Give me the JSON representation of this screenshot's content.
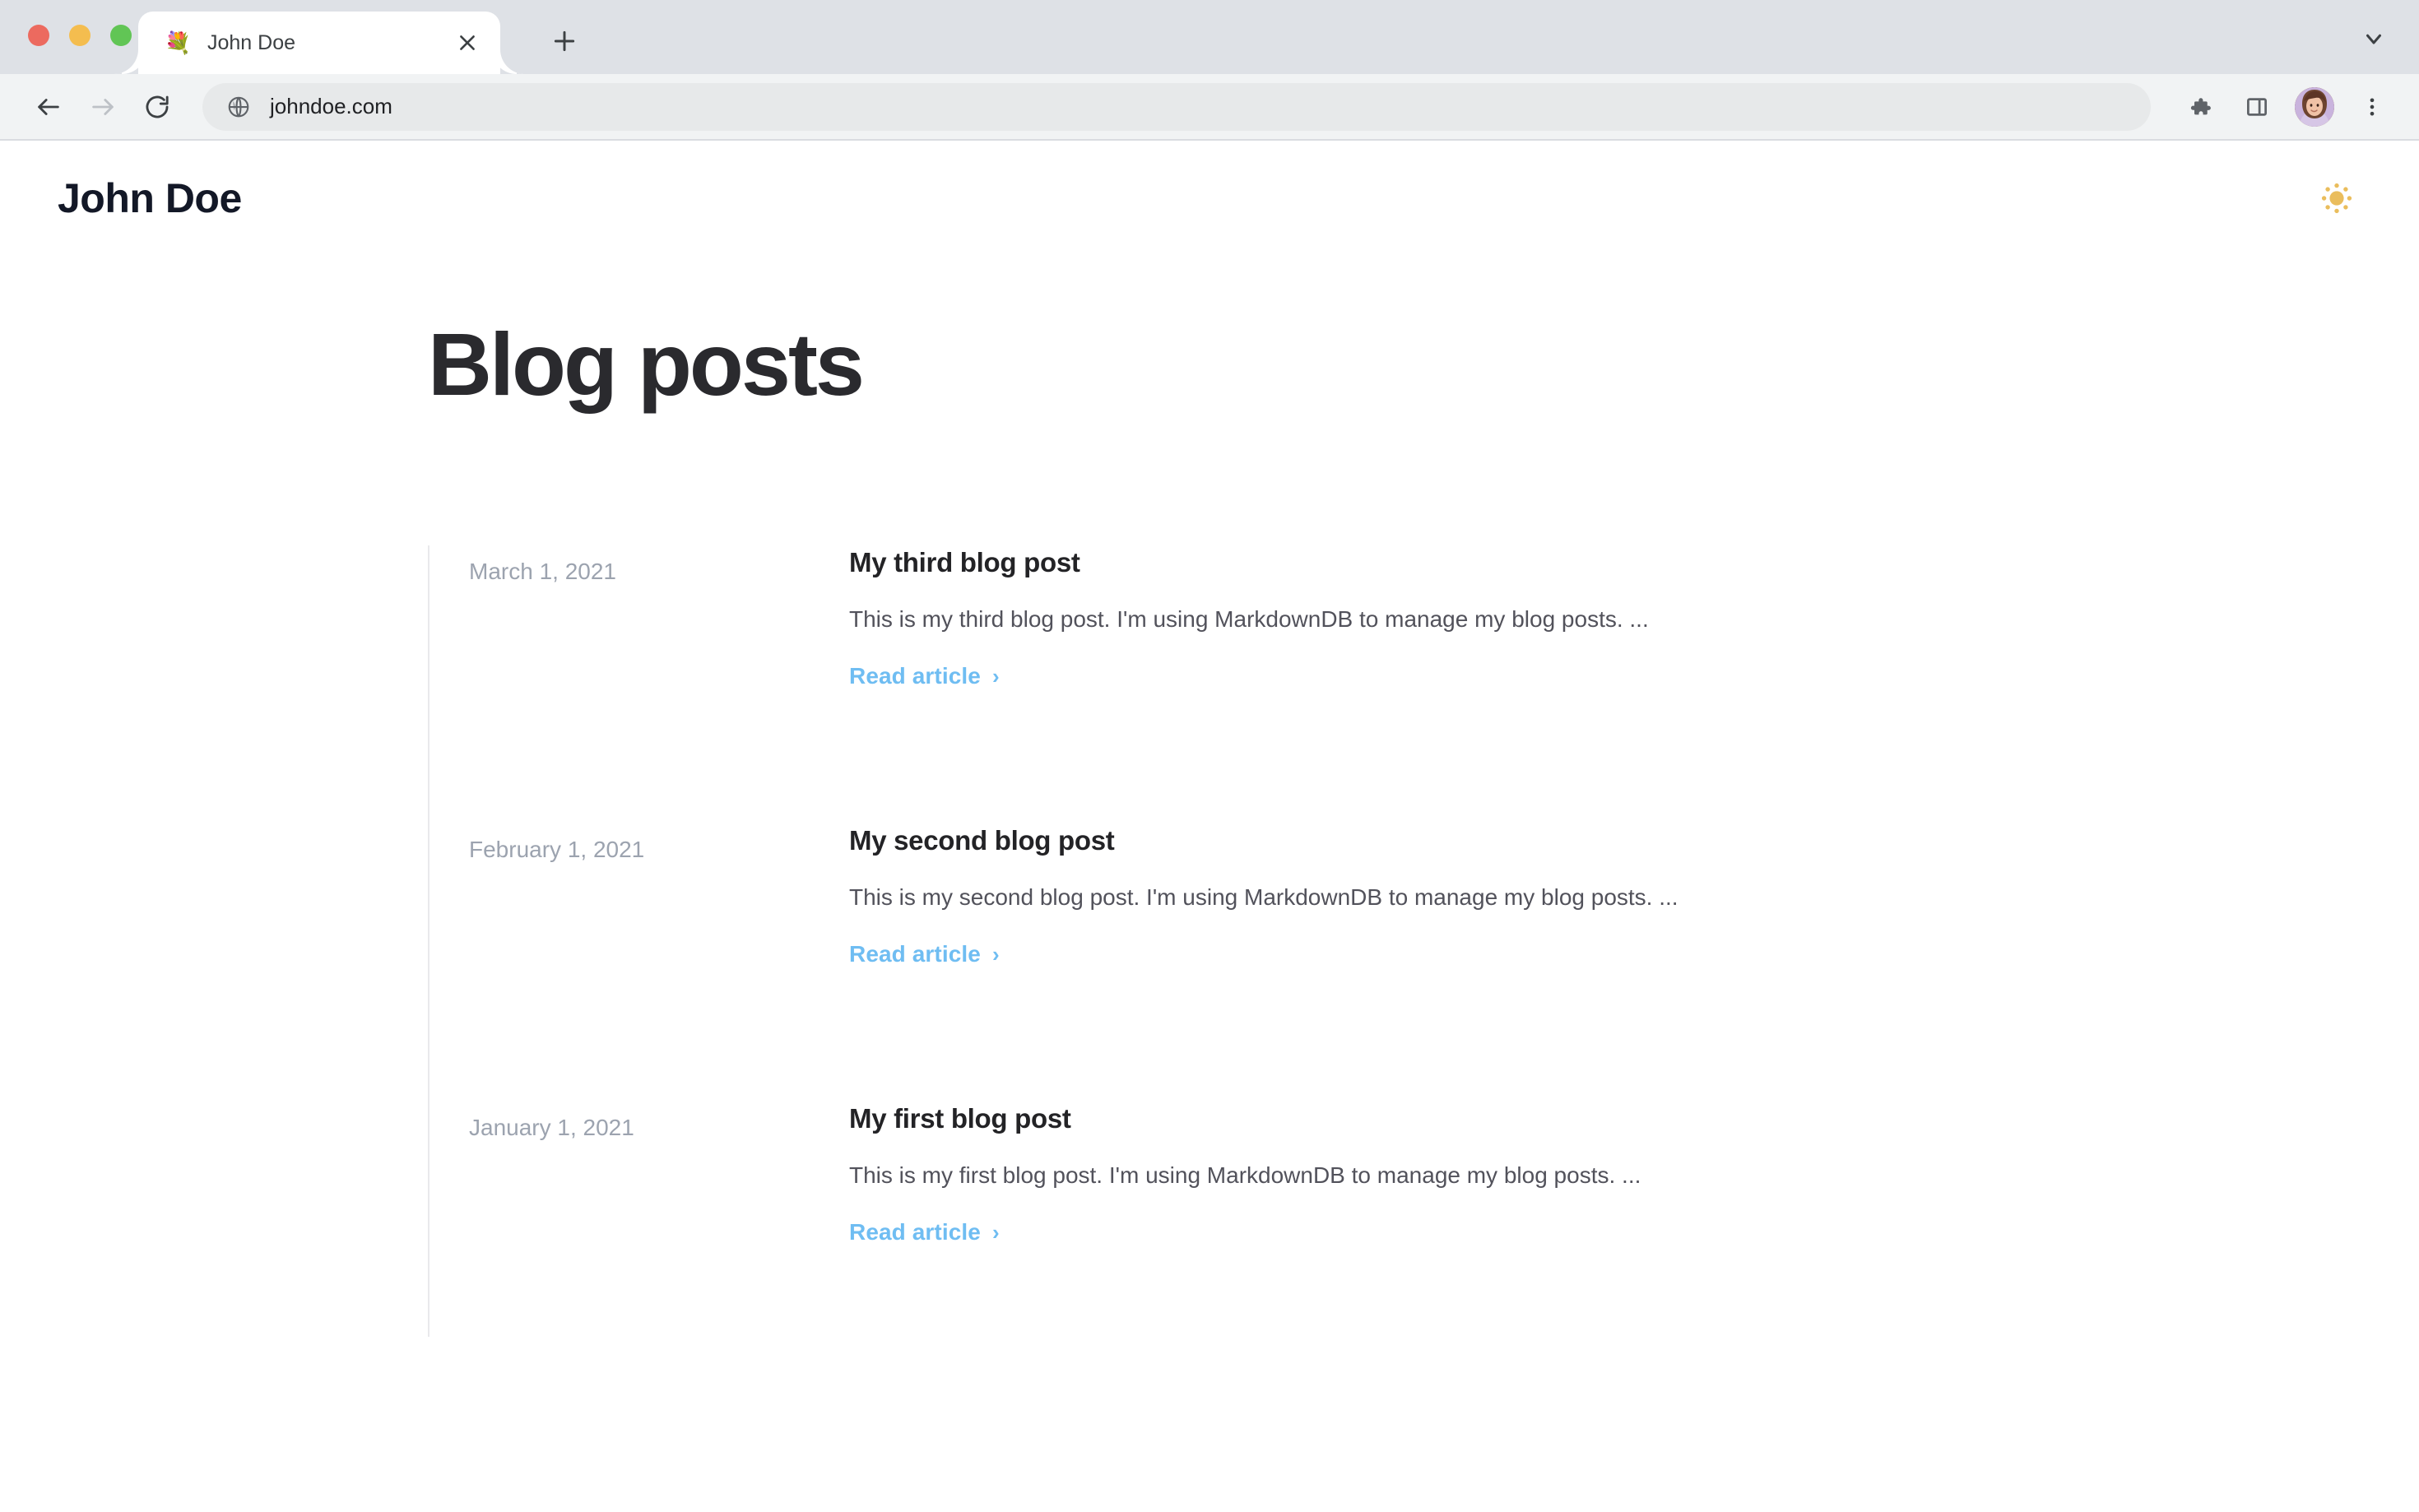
{
  "browser": {
    "window_controls": {
      "close_label": "close",
      "minimize_label": "minimize",
      "zoom_label": "zoom",
      "close_color": "#ec6a5f",
      "minimize_color": "#f4bd4f",
      "zoom_color": "#61c555"
    },
    "tab": {
      "favicon": "💐",
      "title": "John Doe",
      "close_icon": "×"
    },
    "new_tab_icon": "+",
    "tab_search_icon": "chevron-down-icon",
    "toolbar": {
      "back_icon": "←",
      "forward_icon": "→",
      "reload_icon": "⟳",
      "site_icon": "globe-icon",
      "url": "johndoe.com",
      "extensions_icon": "puzzle-icon",
      "side_panel_icon": "side-panel-icon",
      "profile_icon": "avatar",
      "menu_icon": "⋮"
    }
  },
  "site": {
    "logo": "John Doe",
    "theme_toggle_icon": "sun-icon",
    "theme_toggle_color": "#eabd5c"
  },
  "main": {
    "title": "Blog posts",
    "accent_link_color": "#6fbdf2",
    "posts": [
      {
        "date": "March 1, 2021",
        "title": "My third blog post",
        "excerpt": "This is my third blog post. I'm using MarkdownDB to manage my blog posts. ...",
        "link_label": "Read article",
        "link_chevron": "›"
      },
      {
        "date": "February 1, 2021",
        "title": "My second blog post",
        "excerpt": "This is my second blog post. I'm using MarkdownDB to manage my blog posts. ...",
        "link_label": "Read article",
        "link_chevron": "›"
      },
      {
        "date": "January 1, 2021",
        "title": "My first blog post",
        "excerpt": "This is my first blog post. I'm using MarkdownDB to manage my blog posts. ...",
        "link_label": "Read article",
        "link_chevron": "›"
      }
    ]
  }
}
